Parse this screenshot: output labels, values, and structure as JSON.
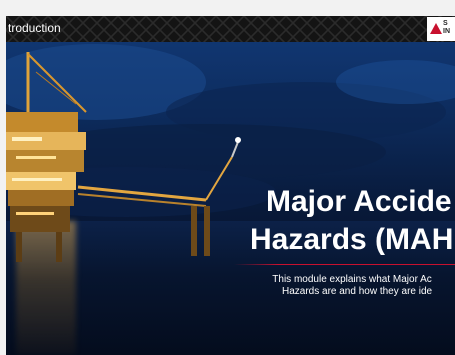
{
  "topbar": {
    "title": "troduction",
    "logo_text_line1": "S",
    "logo_text_line2": "IN"
  },
  "slide": {
    "headline_line1": "Major Accide",
    "headline_line2": "Hazards (MAH",
    "subtitle_line1": "This module explains what Major Ac",
    "subtitle_line2": "Hazards are and how they are ide"
  },
  "colors": {
    "accent_red": "#c8102e",
    "topbar_bg": "#141414",
    "sky_top": "#123a78",
    "sea_dark": "#050e22"
  }
}
